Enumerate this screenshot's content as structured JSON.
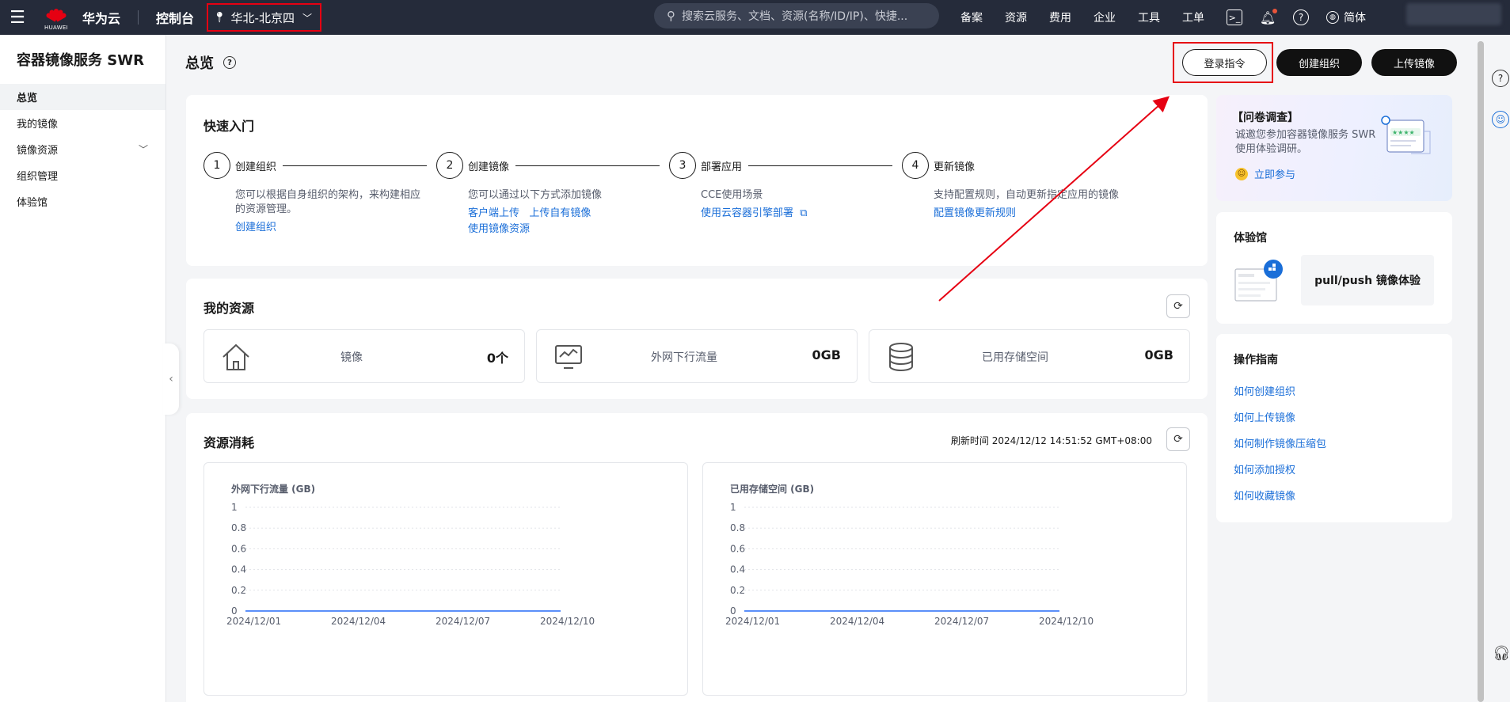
{
  "topbar": {
    "brand_sub": "HUAWEI",
    "brand": "华为云",
    "console": "控制台",
    "region": "华北-北京四",
    "search_placeholder": "搜索云服务、文档、资源(名称/ID/IP)、快捷...",
    "nav": [
      "备案",
      "资源",
      "费用",
      "企业",
      "工具",
      "工单"
    ],
    "lang": "简体"
  },
  "sidebar": {
    "title": "容器镜像服务 SWR",
    "items": [
      {
        "label": "总览"
      },
      {
        "label": "我的镜像"
      },
      {
        "label": "镜像资源"
      },
      {
        "label": "组织管理"
      },
      {
        "label": "体验馆"
      }
    ]
  },
  "page": {
    "title": "总览",
    "actions": {
      "login": "登录指令",
      "create_org": "创建组织",
      "upload": "上传镜像"
    }
  },
  "quick_start": {
    "title": "快速入门",
    "steps": [
      {
        "num": "1",
        "name": "创建组织",
        "desc": "您可以根据自身组织的架构，来构建相应的资源管理。",
        "links": [
          "创建组织"
        ]
      },
      {
        "num": "2",
        "name": "创建镜像",
        "desc": "您可以通过以下方式添加镜像",
        "links": [
          "客户端上传",
          "上传自有镜像",
          "使用镜像资源"
        ]
      },
      {
        "num": "3",
        "name": "部署应用",
        "desc": "CCE使用场景",
        "links": [
          "使用云容器引擎部署"
        ]
      },
      {
        "num": "4",
        "name": "更新镜像",
        "desc": "支持配置规则，自动更新指定应用的镜像",
        "links": [
          "配置镜像更新规则"
        ]
      }
    ]
  },
  "resources": {
    "title": "我的资源",
    "items": [
      {
        "label": "镜像",
        "value": "0个"
      },
      {
        "label": "外网下行流量",
        "value": "0GB"
      },
      {
        "label": "已用存储空间",
        "value": "0GB"
      }
    ]
  },
  "consumption": {
    "title": "资源消耗",
    "refresh_label": "刷新时间 2024/12/12 14:51:52 GMT+08:00"
  },
  "chart_data": [
    {
      "type": "line",
      "title": "外网下行流量 (GB)",
      "x": [
        "2024/12/01",
        "2024/12/04",
        "2024/12/07",
        "2024/12/10"
      ],
      "y_ticks": [
        0,
        0.2,
        0.4,
        0.6,
        0.8,
        1
      ],
      "ylim": [
        0,
        1
      ],
      "series": [
        {
          "values": [
            0,
            0,
            0,
            0
          ]
        }
      ],
      "line_color": "#5b8ff9"
    },
    {
      "type": "line",
      "title": "已用存储空间 (GB)",
      "x": [
        "2024/12/01",
        "2024/12/04",
        "2024/12/07",
        "2024/12/10"
      ],
      "y_ticks": [
        0,
        0.2,
        0.4,
        0.6,
        0.8,
        1
      ],
      "ylim": [
        0,
        1
      ],
      "series": [
        {
          "values": [
            0,
            0,
            0,
            0
          ]
        }
      ],
      "line_color": "#5b8ff9"
    }
  ],
  "survey": {
    "title": "【问卷调查】",
    "desc": "诚邀您参加容器镜像服务 SWR 使用体验调研。",
    "link": "立即参与"
  },
  "lab": {
    "title": "体验馆",
    "item": "pull/push 镜像体验"
  },
  "guide": {
    "title": "操作指南",
    "links": [
      "如何创建组织",
      "如何上传镜像",
      "如何制作镜像压缩包",
      "如何添加授权",
      "如何收藏镜像"
    ]
  },
  "colors": {
    "topbar": "#252b3a",
    "link": "#1a6ed8",
    "annotation": "#e60012",
    "chart_line": "#5b8ff9"
  }
}
